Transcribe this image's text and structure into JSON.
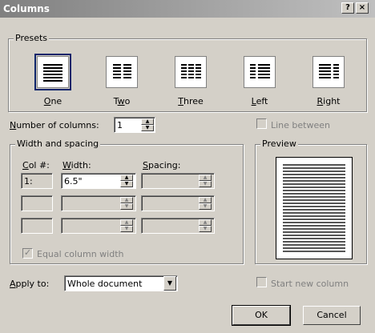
{
  "window": {
    "title": "Columns",
    "help_glyph": "?",
    "close_glyph": "×"
  },
  "presets": {
    "group_label": "Presets",
    "items": [
      {
        "label": "One",
        "mnemonic": "O",
        "rest": "ne"
      },
      {
        "label": "Two",
        "mnemonic": "w",
        "pre": "T",
        "rest": "o"
      },
      {
        "label": "Three",
        "mnemonic": "T",
        "rest": "hree"
      },
      {
        "label": "Left",
        "mnemonic": "L",
        "rest": "eft"
      },
      {
        "label": "Right",
        "mnemonic": "R",
        "rest": "ight"
      }
    ]
  },
  "number_of_columns": {
    "label_pre": "",
    "mnemonic": "N",
    "label_rest": "umber of columns:",
    "value": "1"
  },
  "line_between": {
    "label": "Line between",
    "checked": false,
    "enabled": false
  },
  "width_spacing": {
    "group_label": "Width and spacing",
    "col_header_mnemonic": "C",
    "col_header_rest": "ol #:",
    "width_header_mnemonic": "W",
    "width_header_rest": "idth:",
    "spacing_header_mnemonic": "S",
    "spacing_header_rest": "pacing:",
    "rows": [
      {
        "col": "1:",
        "width": "6.5\"",
        "spacing": ""
      },
      {
        "col": "",
        "width": "",
        "spacing": ""
      },
      {
        "col": "",
        "width": "",
        "spacing": ""
      }
    ]
  },
  "equal_column_width": {
    "label": "Equal column width",
    "checked": true,
    "enabled": false
  },
  "preview": {
    "group_label": "Preview"
  },
  "apply_to": {
    "label_mnemonic": "A",
    "label_rest": "pply to:",
    "value": "Whole document"
  },
  "start_new_column": {
    "label": "Start new column",
    "checked": false,
    "enabled": false
  },
  "buttons": {
    "ok": "OK",
    "cancel": "Cancel"
  }
}
